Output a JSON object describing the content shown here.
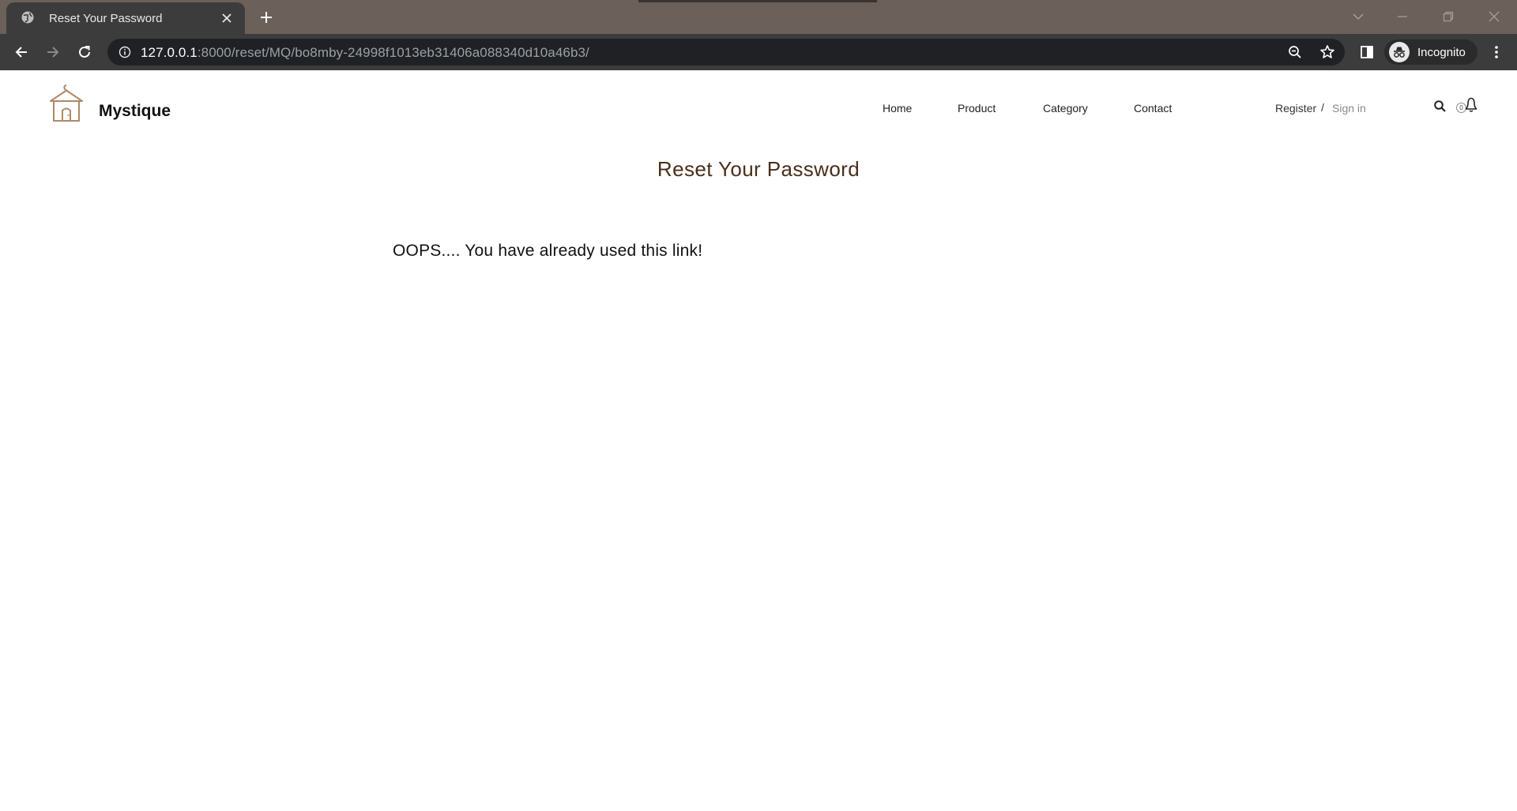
{
  "browser": {
    "tab_title": "Reset Your Password",
    "url_host": "127.0.0.1",
    "url_rest": ":8000/reset/MQ/bo8mby-24998f1013eb31406a088340d10a46b3/",
    "profile_label": "Incognito"
  },
  "site": {
    "brand": "Mystique",
    "nav": {
      "home": "Home",
      "product": "Product",
      "category": "Category",
      "contact": "Contact"
    },
    "auth": {
      "register": "Register",
      "separator": "/",
      "signin": "Sign in"
    },
    "cart_count": "0"
  },
  "main": {
    "title": "Reset Your Password",
    "message": "OOPS.... You have already used this link!"
  },
  "colors": {
    "title": "#4a2e1c",
    "logo": "#b08968",
    "tabstrip": "#6b605a"
  }
}
